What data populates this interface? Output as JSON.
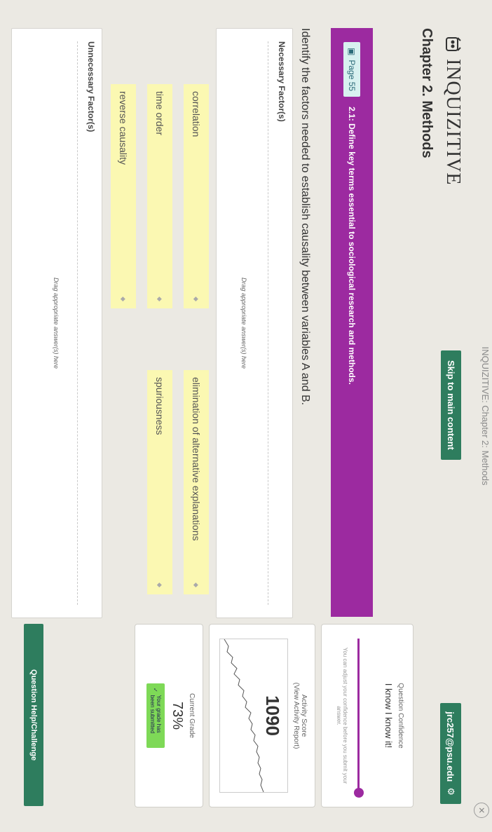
{
  "browser": {
    "title": "INQUIZITIVE: Chapter 2: Methods"
  },
  "header": {
    "logo_text": "INQUIZITIVE",
    "skip_label": "Skip to main content",
    "user": "jrc257@psu.edu"
  },
  "chapter": {
    "title": "Chapter 2. Methods"
  },
  "objective": {
    "page_label": "Page 55",
    "text": "2.1: Define key terms essential to sociological research and methods."
  },
  "question": {
    "text": "Identify the factors needed to establish causality between variables A and B."
  },
  "zones": {
    "necessary": {
      "label": "Necessary Factor(s)",
      "hint": "Drag appropriate answer(s) here"
    },
    "unnecessary": {
      "label": "Unnecessary Factor(s)",
      "hint": "Drag appropriate answer(s) here"
    }
  },
  "answers": [
    "correlation",
    "elimination of alternative explanations",
    "time order",
    "spuriousness",
    "reverse causality"
  ],
  "sidebar": {
    "confidence": {
      "title": "Question Confidence",
      "value": "I know I know it!",
      "note": "You can adjust your confidence before you submit your answer.",
      "level": 1.0
    },
    "activity": {
      "title": "Activity Score",
      "subtitle": "(View Activity Report)",
      "score": "1090"
    },
    "grade": {
      "title": "Current Grade",
      "value": "73%",
      "note": "Your grade has been submitted"
    },
    "help_label": "Question Help/Challenge"
  },
  "colors": {
    "purple": "#9c2aa0",
    "green": "#2e7d5e",
    "chip": "#fbf8b2"
  }
}
